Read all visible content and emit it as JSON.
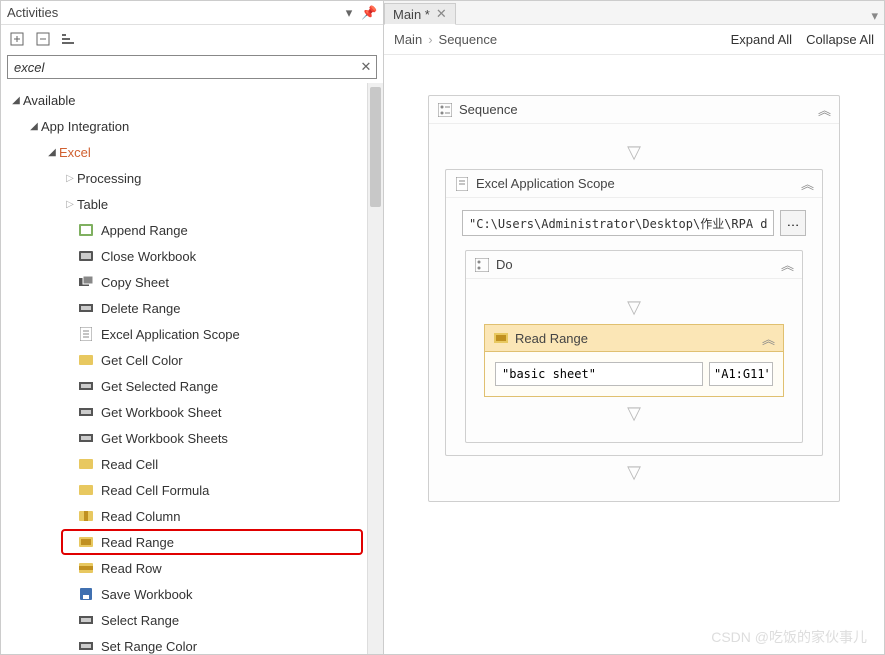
{
  "panel": {
    "title": "Activities"
  },
  "search": {
    "value": "excel"
  },
  "tree": {
    "root": "Available",
    "group": "App Integration",
    "excel": "Excel",
    "processing": "Processing",
    "table": "Table",
    "items": {
      "append_range": "Append Range",
      "close_workbook": "Close Workbook",
      "copy_sheet": "Copy Sheet",
      "delete_range": "Delete Range",
      "excel_app_scope_pre": "Excel",
      "excel_app_scope_post": " Application Scope",
      "get_cell_color": "Get Cell Color",
      "get_selected_range": "Get Selected Range",
      "get_workbook_sheet": "Get Workbook Sheet",
      "get_workbook_sheets": "Get Workbook Sheets",
      "read_cell": "Read Cell",
      "read_cell_formula": "Read Cell Formula",
      "read_column": "Read Column",
      "read_range": "Read Range",
      "read_row": "Read Row",
      "save_workbook": "Save Workbook",
      "select_range": "Select Range",
      "set_range_color": "Set Range Color"
    }
  },
  "tab": {
    "label": "Main *"
  },
  "breadcrumb": {
    "root": "Main",
    "child": "Sequence"
  },
  "actions": {
    "expand": "Expand All",
    "collapse": "Collapse All"
  },
  "workflow": {
    "sequence": "Sequence",
    "scope": "Excel Application Scope",
    "scope_path": "\"C:\\Users\\Administrator\\Desktop\\作业\\RPA data.xlsx\"",
    "do": "Do",
    "readrange": "Read Range",
    "rr_sheet": "\"basic sheet\"",
    "rr_range": "\"A1:G11\""
  },
  "watermark": "CSDN @吃饭的家伙事儿"
}
